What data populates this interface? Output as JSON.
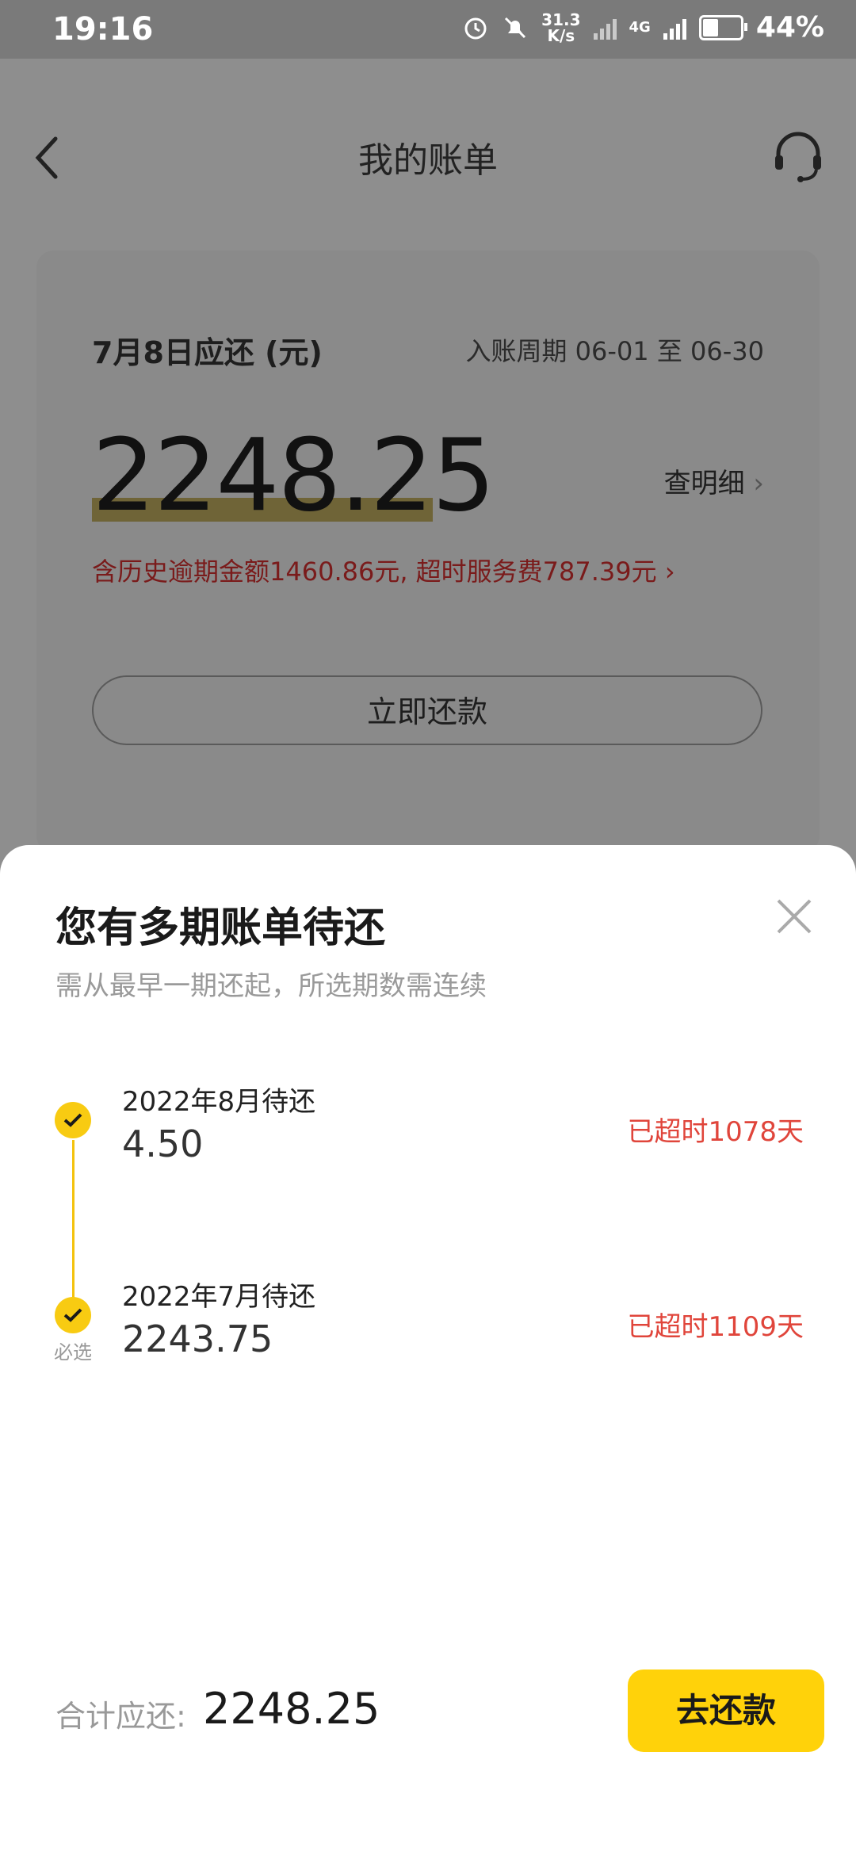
{
  "status_bar": {
    "time": "19:16",
    "net_speed_top": "31.3",
    "net_speed_bottom": "K/s",
    "network": "4G",
    "battery": "44%",
    "battery_level": 0.44
  },
  "header": {
    "title": "我的账单"
  },
  "bill_card": {
    "due_label": "7月8日应还 (元)",
    "period": "入账周期 06-01 至 06-30",
    "amount": "2248.25",
    "detail_label": "查明细",
    "overdue_note": "含历史逾期金额1460.86元, 超时服务费787.39元",
    "pay_now": "立即还款"
  },
  "sheet": {
    "title": "您有多期账单待还",
    "subtitle": "需从最早一期还起，所选期数需连续",
    "items": [
      {
        "label": "2022年8月待还",
        "amount": "4.50",
        "status": "已超时1078天"
      },
      {
        "label": "2022年7月待还",
        "amount": "2243.75",
        "status": "已超时1109天",
        "tag": "必选"
      }
    ],
    "total_label": "合计应还:",
    "total_value": "2248.25",
    "pay_button": "去还款"
  },
  "colors": {
    "accent": "#ffd20a",
    "overdue_red": "#e0453b",
    "check_yellow": "#f8cb12"
  }
}
